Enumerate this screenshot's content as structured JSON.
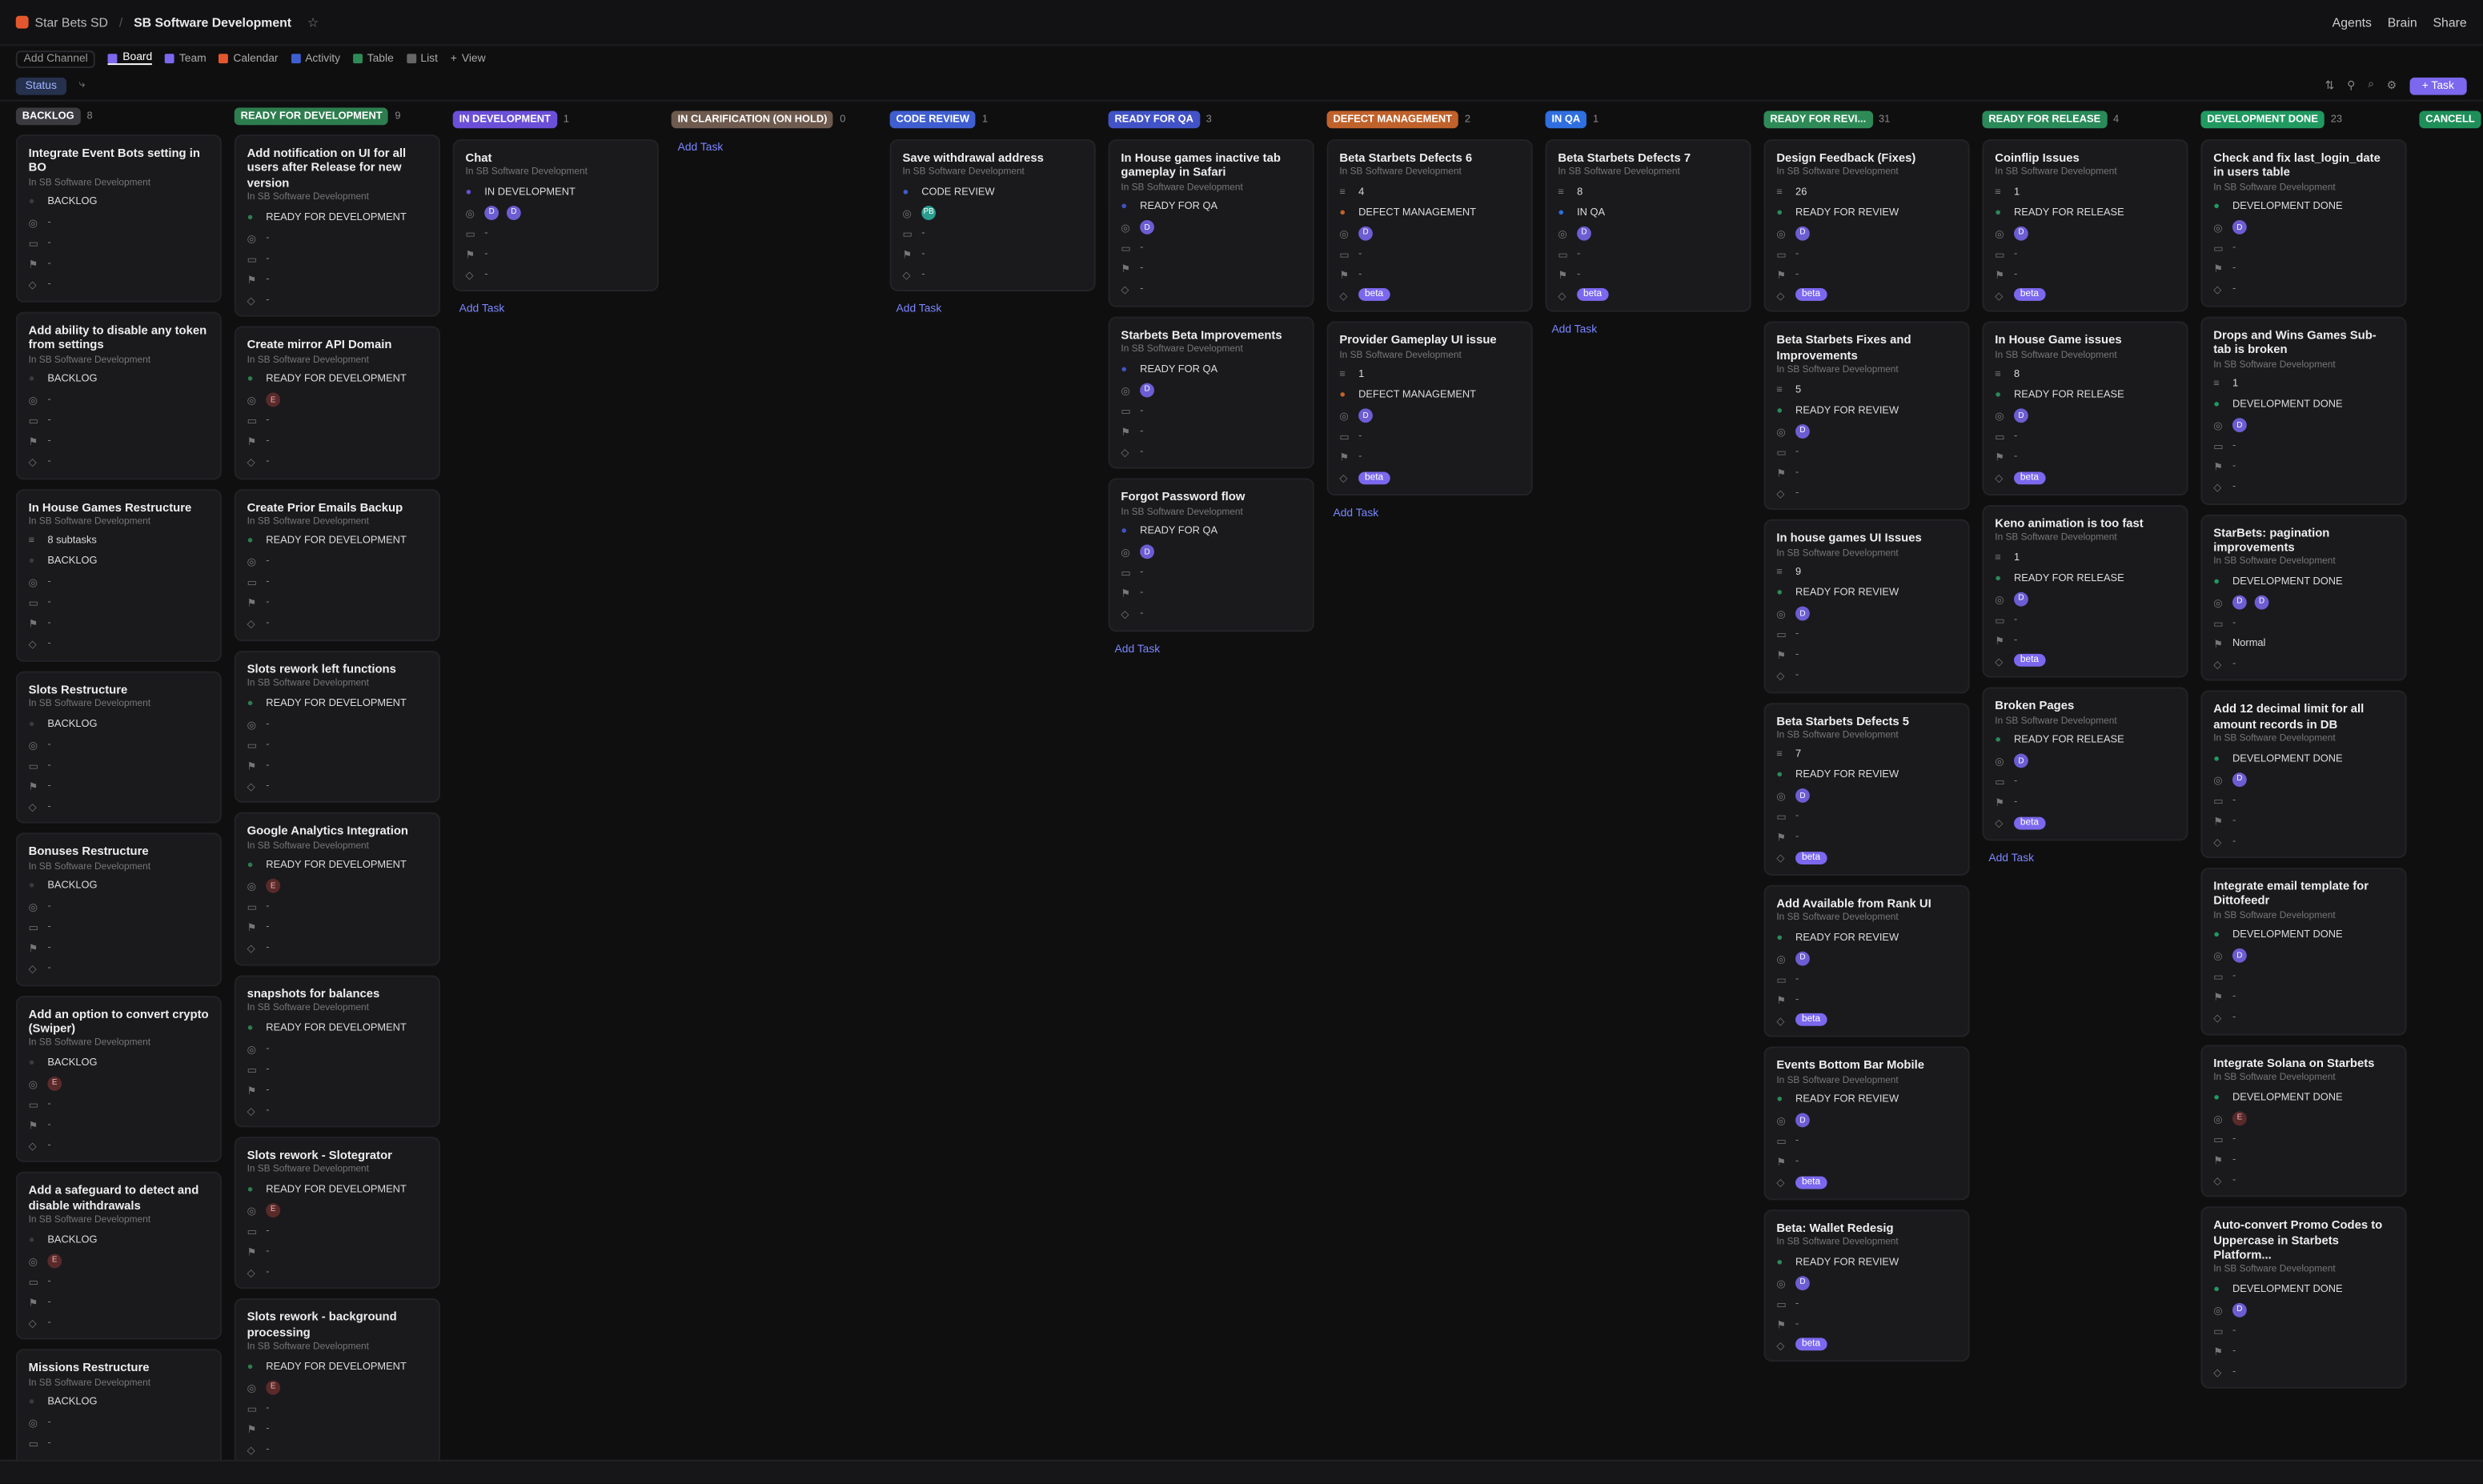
{
  "header": {
    "workspace": "Star Bets SD",
    "space": "SB Software Development",
    "right": [
      "Agents",
      "Brain",
      "Share"
    ]
  },
  "viewbar": {
    "add_channel": "Add Channel",
    "tabs": [
      "Board",
      "Team",
      "Calendar",
      "Activity",
      "Table",
      "List"
    ],
    "add_view": "View"
  },
  "filterbar": {
    "status": "Status",
    "task_button": "Task"
  },
  "location": "In SB Software Development",
  "add_task": "Add Task",
  "columns": [
    {
      "label": "BACKLOG",
      "count": "8",
      "color": "#3a3a3f",
      "cards": [
        {
          "title": "Integrate Event Bots setting in BO",
          "status": "BACKLOG",
          "assignees": [],
          "tag": "",
          "extra": ""
        },
        {
          "title": "Add ability to disable any token from settings",
          "status": "BACKLOG",
          "assignees": [],
          "tag": "",
          "extra": ""
        },
        {
          "title": "In House Games Restructure",
          "status": "BACKLOG",
          "assignees": [],
          "tag": "",
          "extra": "8 subtasks"
        },
        {
          "title": "Slots Restructure",
          "status": "BACKLOG",
          "assignees": [],
          "tag": "",
          "extra": ""
        },
        {
          "title": "Bonuses Restructure",
          "status": "BACKLOG",
          "assignees": [],
          "tag": "",
          "extra": ""
        },
        {
          "title": "Add an option to convert crypto (Swiper)",
          "status": "BACKLOG",
          "assignees": [
            "E"
          ],
          "tag": "",
          "extra": ""
        },
        {
          "title": "Add a safeguard to detect and disable withdrawals",
          "status": "BACKLOG",
          "assignees": [
            "E"
          ],
          "tag": "",
          "extra": ""
        },
        {
          "title": "Missions Restructure",
          "status": "BACKLOG",
          "assignees": [],
          "tag": "",
          "extra": ""
        }
      ]
    },
    {
      "label": "READY FOR DEVELOPMENT",
      "count": "9",
      "color": "#2e7d4f",
      "cards": [
        {
          "title": "Add notification on UI for all users after Release for new version",
          "status": "READY FOR DEVELOPMENT",
          "assignees": [],
          "tag": "",
          "extra": ""
        },
        {
          "title": "Create mirror API Domain",
          "status": "READY FOR DEVELOPMENT",
          "assignees": [
            "E"
          ],
          "tag": "",
          "extra": ""
        },
        {
          "title": "Create Prior Emails Backup",
          "status": "READY FOR DEVELOPMENT",
          "assignees": [],
          "tag": "",
          "extra": ""
        },
        {
          "title": "Slots rework left functions",
          "status": "READY FOR DEVELOPMENT",
          "assignees": [],
          "tag": "",
          "extra": ""
        },
        {
          "title": "Google Analytics Integration",
          "status": "READY FOR DEVELOPMENT",
          "assignees": [
            "E"
          ],
          "tag": "",
          "extra": ""
        },
        {
          "title": "snapshots for balances",
          "status": "READY FOR DEVELOPMENT",
          "assignees": [],
          "tag": "",
          "extra": ""
        },
        {
          "title": "Slots rework - Slotegrator",
          "status": "READY FOR DEVELOPMENT",
          "assignees": [
            "E"
          ],
          "tag": "",
          "extra": ""
        },
        {
          "title": "Slots rework - background processing",
          "status": "READY FOR DEVELOPMENT",
          "assignees": [
            "E"
          ],
          "tag": "",
          "extra": ""
        }
      ]
    },
    {
      "label": "IN DEVELOPMENT",
      "count": "1",
      "color": "#6b4fd8",
      "cards": [
        {
          "title": "Chat",
          "status": "IN DEVELOPMENT",
          "assignees": [
            "D",
            "D"
          ],
          "tag": "",
          "extra": ""
        }
      ]
    },
    {
      "label": "IN CLARIFICATION (ON HOLD)",
      "count": "0",
      "color": "#6e5a4e",
      "cards": []
    },
    {
      "label": "CODE REVIEW",
      "count": "1",
      "color": "#3f5fd0",
      "cards": [
        {
          "title": "Save withdrawal address",
          "status": "CODE REVIEW",
          "assignees": [
            "PB"
          ],
          "tag": "",
          "extra": ""
        }
      ]
    },
    {
      "label": "READY FOR QA",
      "count": "3",
      "color": "#4253c7",
      "cards": [
        {
          "title": "In House games inactive tab gameplay in Safari",
          "status": "READY FOR QA",
          "assignees": [
            "D"
          ],
          "tag": "",
          "extra": ""
        },
        {
          "title": "Starbets Beta Improvements",
          "status": "READY FOR QA",
          "assignees": [
            "D"
          ],
          "tag": "",
          "extra": ""
        },
        {
          "title": "Forgot Password flow",
          "status": "READY FOR QA",
          "assignees": [
            "D"
          ],
          "tag": "",
          "extra": ""
        }
      ]
    },
    {
      "label": "DEFECT MANAGEMENT",
      "count": "2",
      "color": "#c0622b",
      "cards": [
        {
          "title": "Beta Starbets Defects 6",
          "status": "DEFECT MANAGEMENT",
          "assignees": [
            "D"
          ],
          "tag": "beta",
          "extra": "4"
        },
        {
          "title": "Provider Gameplay UI issue",
          "status": "DEFECT MANAGEMENT",
          "assignees": [
            "D"
          ],
          "tag": "beta",
          "extra": "1"
        }
      ]
    },
    {
      "label": "IN QA",
      "count": "1",
      "color": "#2f6fe0",
      "cards": [
        {
          "title": "Beta Starbets Defects 7",
          "status": "IN QA",
          "assignees": [
            "D"
          ],
          "tag": "beta",
          "extra": "8"
        }
      ]
    },
    {
      "label": "READY FOR REVI...",
      "count": "31",
      "color": "#2e8b57",
      "cards": [
        {
          "title": "Design Feedback (Fixes)",
          "status": "READY FOR REVIEW",
          "assignees": [
            "D"
          ],
          "tag": "beta",
          "extra": "26"
        },
        {
          "title": "Beta Starbets Fixes and Improvements",
          "status": "READY FOR REVIEW",
          "assignees": [
            "D"
          ],
          "tag": "",
          "extra": "5"
        },
        {
          "title": "In house games UI Issues",
          "status": "READY FOR REVIEW",
          "assignees": [
            "D"
          ],
          "tag": "",
          "extra": "9"
        },
        {
          "title": "Beta Starbets Defects 5",
          "status": "READY FOR REVIEW",
          "assignees": [
            "D"
          ],
          "tag": "beta",
          "extra": "7"
        },
        {
          "title": "Add Available from Rank UI",
          "status": "READY FOR REVIEW",
          "assignees": [
            "D"
          ],
          "tag": "beta",
          "extra": ""
        },
        {
          "title": "Events Bottom Bar Mobile",
          "status": "READY FOR REVIEW",
          "assignees": [
            "D"
          ],
          "tag": "beta",
          "extra": ""
        },
        {
          "title": "Beta: Wallet Redesig",
          "status": "READY FOR REVIEW",
          "assignees": [
            "D"
          ],
          "tag": "beta",
          "extra": ""
        }
      ]
    },
    {
      "label": "READY FOR RELEASE",
      "count": "4",
      "color": "#2a8a5a",
      "cards": [
        {
          "title": "Coinflip Issues",
          "status": "READY FOR RELEASE",
          "assignees": [
            "D"
          ],
          "tag": "beta",
          "extra": "1"
        },
        {
          "title": "In House Game issues",
          "status": "READY FOR RELEASE",
          "assignees": [
            "D"
          ],
          "tag": "beta",
          "extra": "8"
        },
        {
          "title": "Keno animation is too fast",
          "status": "READY FOR RELEASE",
          "assignees": [
            "D"
          ],
          "tag": "beta",
          "extra": "1"
        },
        {
          "title": "Broken Pages",
          "status": "READY FOR RELEASE",
          "assignees": [
            "D"
          ],
          "tag": "beta",
          "extra": ""
        }
      ]
    },
    {
      "label": "DEVELOPMENT DONE",
      "count": "23",
      "color": "#219a62",
      "cards": [
        {
          "title": "Check and fix last_login_date in users table",
          "status": "DEVELOPMENT DONE",
          "assignees": [
            "D"
          ],
          "tag": "",
          "extra": ""
        },
        {
          "title": "Drops and Wins Games Sub-tab is broken",
          "status": "DEVELOPMENT DONE",
          "assignees": [
            "D"
          ],
          "tag": "",
          "extra": "1"
        },
        {
          "title": "StarBets: pagination improvements",
          "status": "DEVELOPMENT DONE",
          "assignees": [
            "D",
            "D"
          ],
          "tag": "",
          "extra": "Normal"
        },
        {
          "title": "Add 12 decimal limit for all amount records in DB",
          "status": "DEVELOPMENT DONE",
          "assignees": [
            "D"
          ],
          "tag": "",
          "extra": ""
        },
        {
          "title": "Integrate email template for Dittofeedr",
          "status": "DEVELOPMENT DONE",
          "assignees": [
            "D"
          ],
          "tag": "",
          "extra": ""
        },
        {
          "title": "Integrate Solana on Starbets",
          "status": "DEVELOPMENT DONE",
          "assignees": [
            "E"
          ],
          "tag": "",
          "extra": ""
        },
        {
          "title": "Auto-convert Promo Codes to Uppercase in Starbets Platform...",
          "status": "DEVELOPMENT DONE",
          "assignees": [
            "D"
          ],
          "tag": "",
          "extra": ""
        }
      ]
    },
    {
      "label": "CANCELL",
      "count": "",
      "color": "#1f8f5a",
      "cards": []
    }
  ]
}
